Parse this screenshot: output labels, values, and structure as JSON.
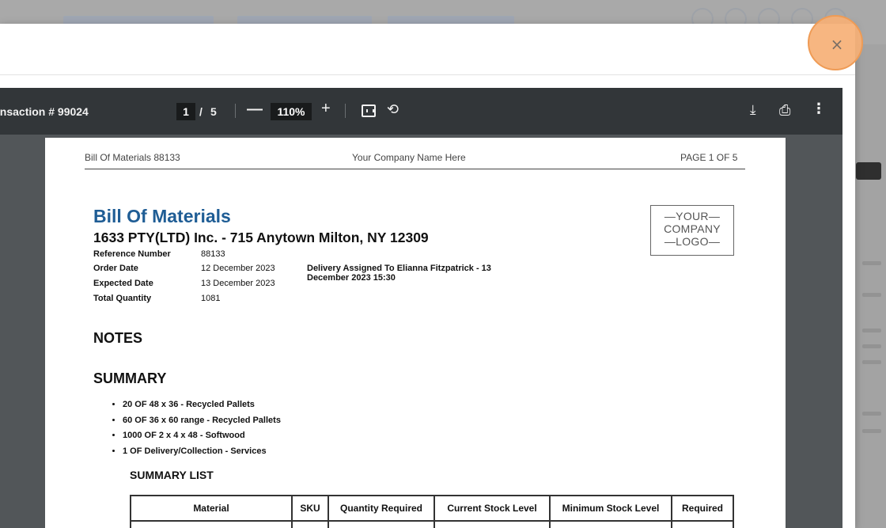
{
  "viewer": {
    "document_title": "ansaction # 99024",
    "current_page": "1",
    "page_separator": "/",
    "total_pages": "5",
    "zoom_minus": "—",
    "zoom_level": "110%",
    "zoom_plus": "+",
    "icons": {
      "fit": "fit-to-page-icon",
      "rotate": "rotate-icon",
      "download": "download-icon",
      "print": "print-icon",
      "more": "more-vertical-icon"
    }
  },
  "modal": {
    "close_label": "×"
  },
  "page": {
    "running_header": {
      "left": "Bill Of Materials 88133",
      "center": "Your Company Name Here",
      "right": "PAGE 1 OF 5"
    },
    "title": "Bill Of Materials",
    "company_address": "1633 PTY(LTD) Inc. - 715 Anytown Milton, NY 12309",
    "meta": [
      {
        "label": "Reference Number",
        "value": "88133"
      },
      {
        "label": "Order Date",
        "value": "12 December 2023"
      },
      {
        "label": "Expected Date",
        "value": "13 December 2023"
      },
      {
        "label": "Total Quantity",
        "value": "1081"
      }
    ],
    "delivery_note": "Delivery Assigned To Elianna Fitzpatrick - 13 December 2023 15:30",
    "logo_lines": [
      "—YOUR—",
      "COMPANY",
      "—LOGO—"
    ],
    "notes_heading": "NOTES",
    "summary_heading": "SUMMARY",
    "summary_items": [
      "20 OF 48 x 36 - Recycled Pallets",
      "60 OF 36 x 60 range - Recycled Pallets",
      "1000 OF 2 x 4 x 48 - Softwood",
      "1 OF Delivery/Collection - Services"
    ],
    "summary_list_heading": "SUMMARY LIST",
    "table_headers": [
      "Material",
      "SKU",
      "Quantity Required",
      "Current Stock Level",
      "Minimum Stock Level",
      "Required"
    ]
  },
  "colors": {
    "title_blue": "#1f5d95",
    "toolbar": "#323639",
    "viewer_bg": "#525659",
    "close_highlight": "#f6b076"
  }
}
